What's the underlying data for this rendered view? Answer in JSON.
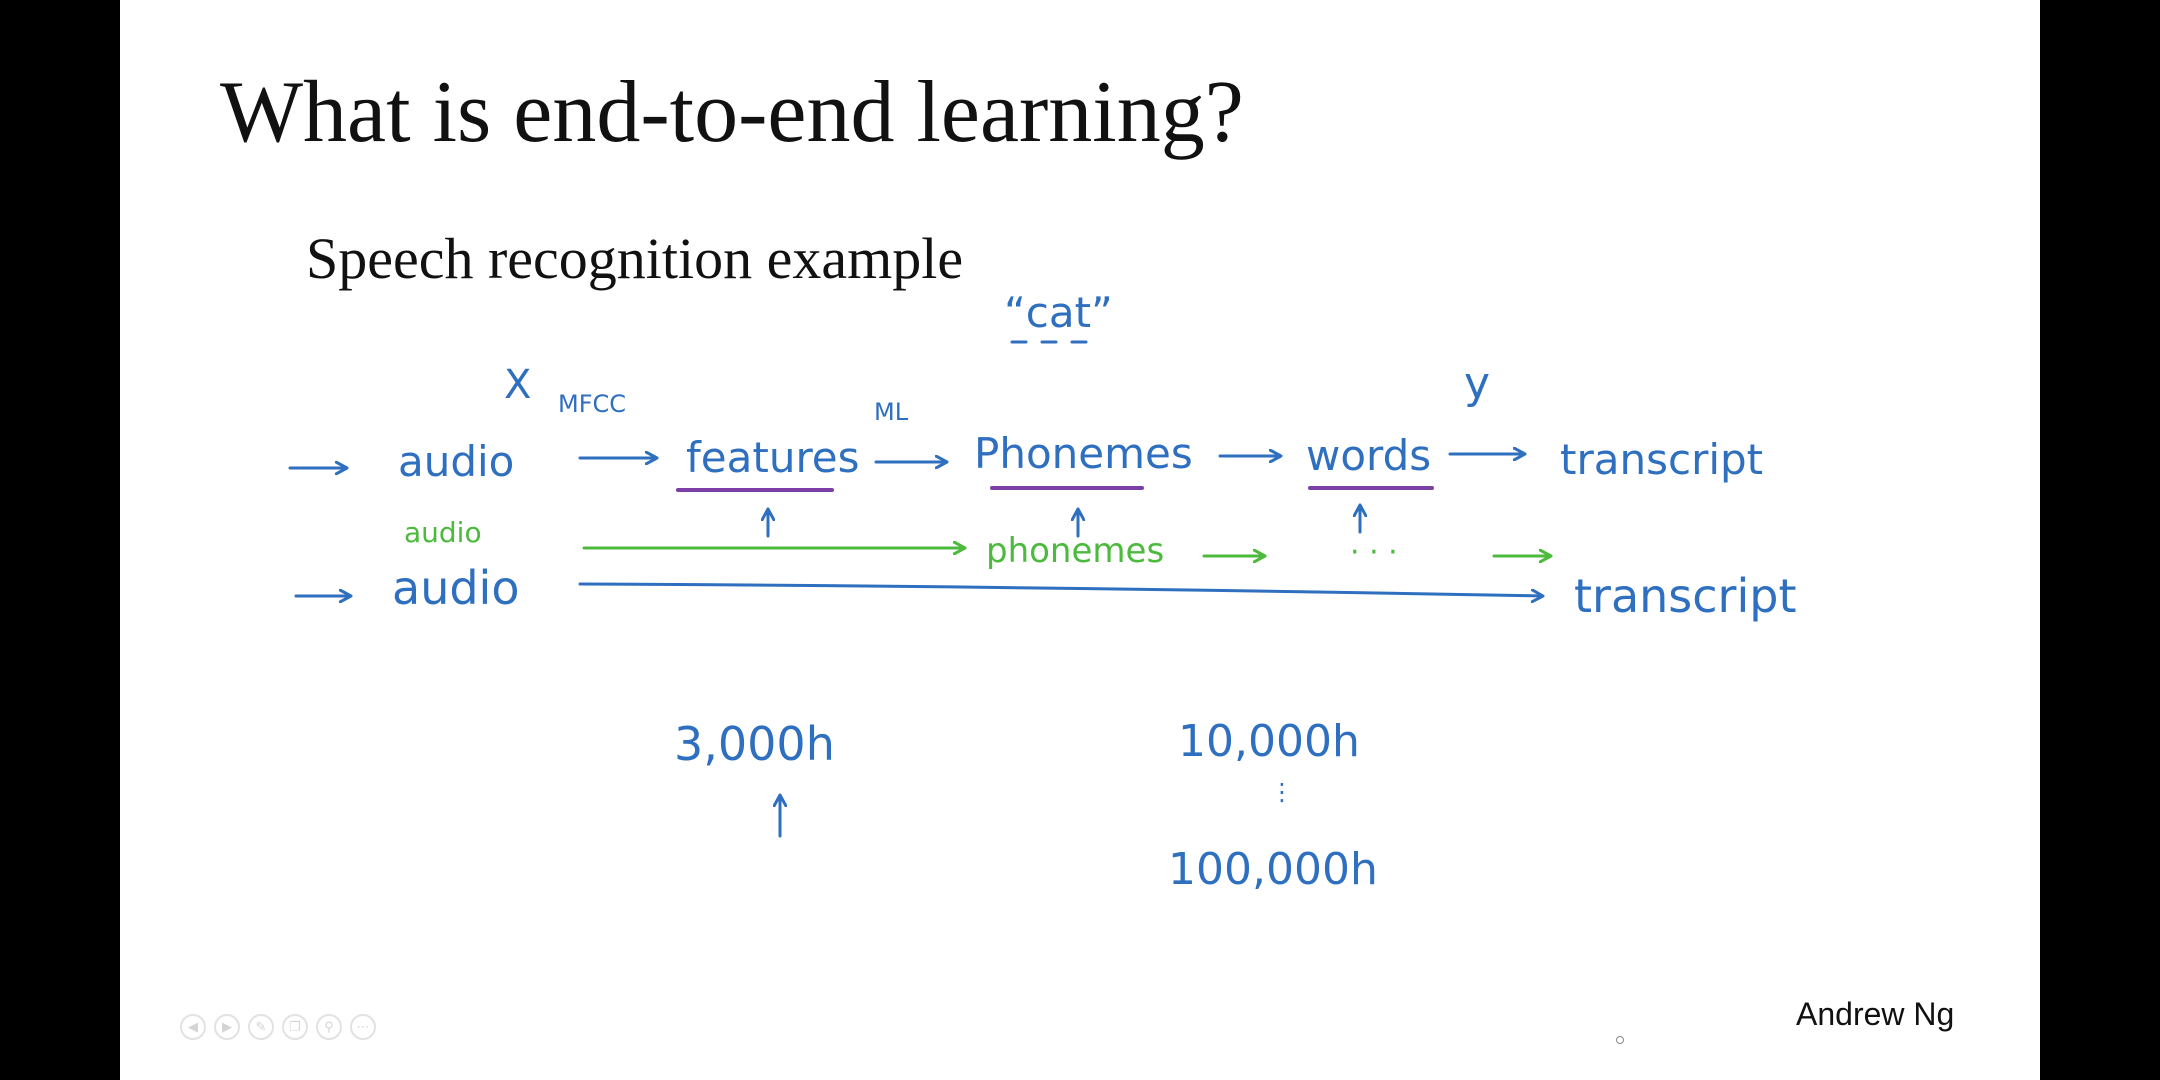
{
  "slide": {
    "title": "What is end-to-end learning?",
    "subtitle": "Speech recognition example",
    "author": "Andrew Ng"
  },
  "annotations": {
    "cat": "“cat”",
    "x_label": "X",
    "y_label": "y",
    "mfcc": "MFCC",
    "ml": "ML",
    "pipeline": [
      "audio",
      "features",
      "Phonemes",
      "words",
      "transcript"
    ],
    "green_row": {
      "audio": "audio",
      "phonemes": "phonemes",
      "dots": "· · ·"
    },
    "e2e_row": {
      "input": "audio",
      "output": "transcript"
    },
    "data_small": "3,000h",
    "data_large_top": "10,000h",
    "data_large_bottom": "100,000h"
  },
  "colors": {
    "blue_ink": "#2f6fbf",
    "green_ink": "#4cbb3d",
    "purple_ink": "#7b3fa6"
  },
  "controls": [
    "prev-icon",
    "next-icon",
    "pen-icon",
    "copy-icon",
    "zoom-icon",
    "more-icon"
  ]
}
